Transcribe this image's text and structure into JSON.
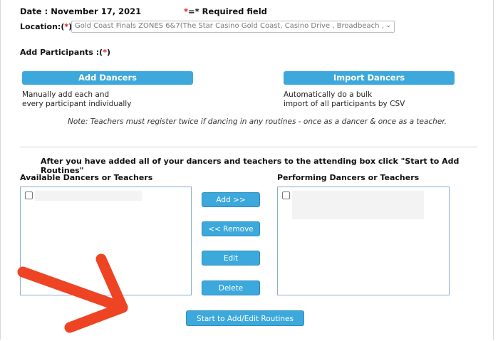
{
  "header": {
    "date": "Date : November 17, 2021",
    "required_star": "*",
    "required_text": "=* Required field"
  },
  "location": {
    "label": "Location:(",
    "star": "*",
    "label_end": ")",
    "selected": "Gold Coast Finals ZONES 6&7(The Star Casino Gold Coast, Casino Drive , Broadbeach ,"
  },
  "participants": {
    "label": "Add Participants :(",
    "star": "*",
    "label_end": ")"
  },
  "actions": {
    "add_dancers": "Add Dancers",
    "add_dancers_desc_1": "Manually add each and",
    "add_dancers_desc_2": "every participant individually",
    "import_dancers": "Import Dancers",
    "import_desc_1": "Automatically do a bulk",
    "import_desc_2": "import of all participants by CSV"
  },
  "note": "Note: Teachers must register twice if dancing in any routines - once as a dancer & once as a teacher.",
  "instruction": "After you have added all of your dancers and teachers to the attending box click \"Start to Add Routines\"",
  "lists": {
    "available_title": "Available Dancers or Teachers",
    "performing_title": "Performing Dancers or Teachers"
  },
  "buttons": {
    "add": "Add >>",
    "remove": "<< Remove",
    "edit": "Edit",
    "delete": "Delete",
    "start": "Start to Add/Edit Routines"
  },
  "colors": {
    "button_blue": "#3ca8db",
    "required_red": "#e21b1b",
    "arrow_red": "#ee4423"
  },
  "icons": {
    "chevron": "chevron-down-icon",
    "annotation": "arrow-pointer-icon"
  }
}
